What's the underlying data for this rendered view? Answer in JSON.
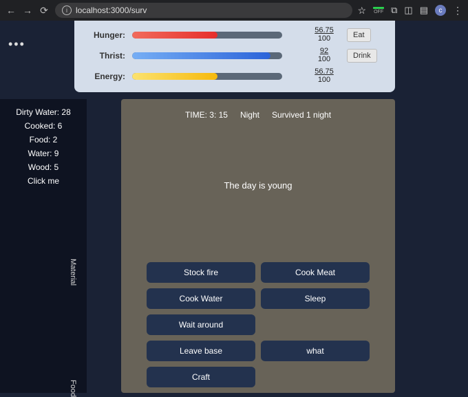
{
  "browser": {
    "url": "localhost:3000/surv",
    "off_label": "OFF",
    "avatar_letter": "c"
  },
  "stats": {
    "hunger": {
      "label": "Hunger:",
      "value": "56.75",
      "max": "100",
      "pct": 56.75
    },
    "thirst": {
      "label": "Thrist:",
      "value": "92",
      "max": "100",
      "pct": 92
    },
    "energy": {
      "label": "Energy:",
      "value": "56.75",
      "max": "100",
      "pct": 56.75
    },
    "eat_label": "Eat",
    "drink_label": "Drink"
  },
  "inventory": {
    "items": [
      "Dirty Water: 28",
      "Cooked: 6",
      "Food: 2",
      "Water: 9",
      "Wood: 5",
      "Click me"
    ],
    "material_label": "Material",
    "food_label": "Food"
  },
  "stage": {
    "time_label": "TIME: 3: 15",
    "phase": "Night",
    "survived": "Survived 1 night",
    "message": "The day is young"
  },
  "actions": {
    "stock_fire": "Stock fire",
    "cook_meat": "Cook Meat",
    "cook_water": "Cook Water",
    "sleep": "Sleep",
    "wait_around": "Wait around",
    "leave_base": "Leave base",
    "what": "what",
    "craft": "Craft"
  }
}
